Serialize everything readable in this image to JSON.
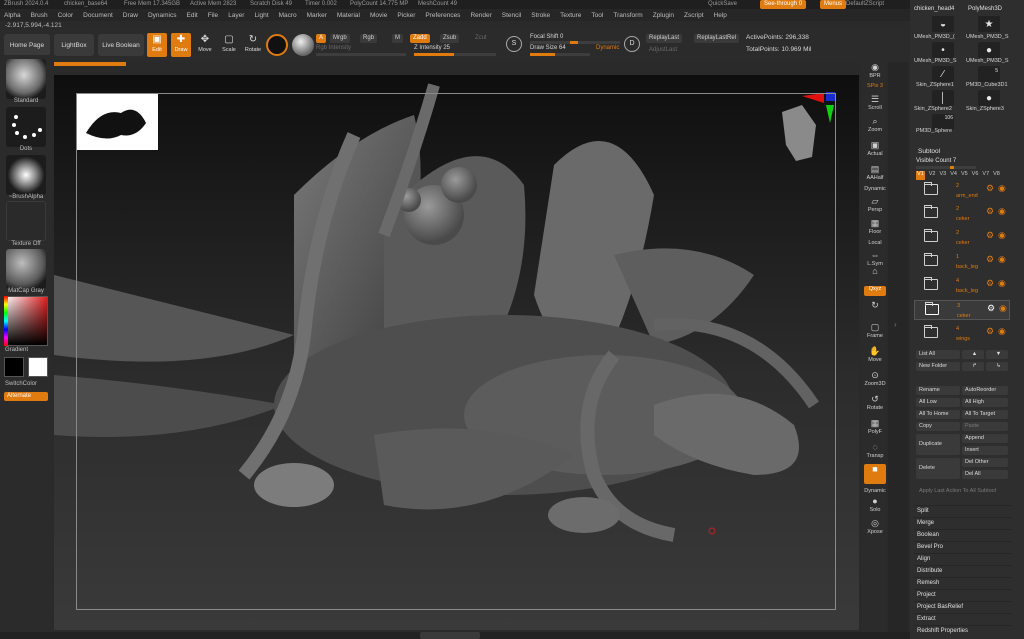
{
  "titlebar": {
    "app": "ZBrush 2024.0.4",
    "doc": "chicken_base64",
    "free_mem": "Free Mem 17.345GB",
    "active_mem": "Active Mem 2823",
    "scratch": "Scratch Disk 49",
    "timer": "Timer 0.002",
    "polycount": "PolyCount 14.775 MP",
    "meshcount": "MeshCount 49",
    "quicksave": "QuickSave",
    "see_through": "See-through 0",
    "menus": "Menus",
    "default_script": "DefaultZScript"
  },
  "menubar": [
    "Alpha",
    "Brush",
    "Color",
    "Document",
    "Draw",
    "Dynamics",
    "Edit",
    "File",
    "Layer",
    "Light",
    "Macro",
    "Marker",
    "Material",
    "Movie",
    "Picker",
    "Preferences",
    "Render",
    "Stencil",
    "Stroke",
    "Texture",
    "Tool",
    "Transform",
    "Zplugin",
    "Zscript",
    "Help"
  ],
  "coords": "-2.917,5.994,-4.121",
  "toolbar": {
    "home_page": "Home Page",
    "lightbox": "LightBox",
    "live_boolean": "Live Boolean",
    "edit": "Edit",
    "draw": "Draw",
    "move": "Move",
    "scale": "Scale",
    "rotate": "Rotate",
    "a_chip": "A",
    "mrgb": "Mrgb",
    "rgb": "Rgb",
    "m": "M",
    "zadd": "Zadd",
    "zsub": "Zsub",
    "zcut": "Zcut",
    "rgb_intensity": "Rgb Intensity",
    "z_intensity": "Z Intensity 25",
    "focal_shift": "Focal Shift 0",
    "draw_size": "Draw Size 64",
    "dynamic": "Dynamic",
    "replay_last": "ReplayLast",
    "replay_last_rel": "ReplayLastRel",
    "adjust_last": "AdjustLast",
    "active_points": "ActivePoints: 296,338",
    "total_points": "TotalPoints: 10.969 Mil"
  },
  "leftshelf": {
    "standard": "Standard",
    "dots": "Dots",
    "brush_alpha": "~BrushAlpha",
    "texture_off": "Texture Off",
    "matcap": "MatCap Gray",
    "gradient": "Gradient",
    "switch_color": "SwitchColor",
    "alternate": "Alternate"
  },
  "rightshelf": [
    {
      "label": "BPR",
      "icon": "bpr-icon"
    },
    {
      "label": "SPix 3",
      "icon": "spix-icon"
    },
    {
      "label": "Scroll",
      "icon": "scroll-icon"
    },
    {
      "label": "Zoom",
      "icon": "zoom-icon"
    },
    {
      "label": "Actual",
      "icon": "actual-icon"
    },
    {
      "label": "AAHalf",
      "icon": "aahalf-icon"
    },
    {
      "label": "Dynamic",
      "icon": "dynamic-icon"
    },
    {
      "label": "Persp",
      "icon": "persp-icon"
    },
    {
      "label": "Floor",
      "icon": "floor-icon"
    },
    {
      "label": "Local",
      "icon": "local-icon"
    },
    {
      "label": "L.Sym",
      "icon": "lsym-icon"
    },
    {
      "label": "Lock",
      "icon": "lock-icon"
    },
    {
      "label": "Qxyz",
      "icon": "xyz-icon"
    },
    {
      "label": "Frame",
      "icon": "frame-icon"
    },
    {
      "label": "Move",
      "icon": "move-icon"
    },
    {
      "label": "Zoom3D",
      "icon": "zoom3d-icon"
    },
    {
      "label": "Rotate",
      "icon": "rotate-icon"
    },
    {
      "label": "PolyF",
      "icon": "polyf-icon"
    },
    {
      "label": "Transp",
      "icon": "transp-icon"
    },
    {
      "label": "Dynamic",
      "icon": "dynamic2-icon"
    },
    {
      "label": "Solo",
      "icon": "solo-icon"
    },
    {
      "label": "Xpose",
      "icon": "xpose-icon"
    }
  ],
  "tools": [
    {
      "label": "chicken_head4"
    },
    {
      "label": "PolyMesh3D"
    },
    {
      "label": "UMesh_PM3D_("
    },
    {
      "label": "UMesh_PM3D_S"
    },
    {
      "label": "UMesh_PM3D_S"
    },
    {
      "label": "UMesh_PM3D_S"
    },
    {
      "label": "Skin_ZSphere1"
    },
    {
      "label": "PM3D_Cube3D1"
    },
    {
      "label": "Skin_ZSphere2"
    },
    {
      "label": "Skin_ZSphere3"
    },
    {
      "label": "PM3D_Sphere"
    }
  ],
  "tool_badges": {
    "five": "5",
    "one_oh_six": "106"
  },
  "subtool": {
    "title": "Subtool",
    "visible_count": "Visible Count 7",
    "tabs": [
      "V1",
      "V2",
      "V3",
      "V4",
      "V5",
      "V6",
      "V7",
      "V8"
    ],
    "rows": [
      {
        "num": "2",
        "name": "arm_end"
      },
      {
        "num": "2",
        "name": "ceker"
      },
      {
        "num": "2",
        "name": "ceker"
      },
      {
        "num": "1",
        "name": "back_leg"
      },
      {
        "num": "4",
        "name": "back_leg"
      },
      {
        "num": "3",
        "name": "ceker"
      },
      {
        "num": "4",
        "name": "wings"
      }
    ],
    "list_all": "List All",
    "new_folder": "New Folder",
    "rename": "Rename",
    "auto_reorder": "AutoReorder",
    "all_low": "All Low",
    "all_high": "All High",
    "all_to_home": "All To Home",
    "all_to_target": "All To Target",
    "copy": "Copy",
    "paste": "Paste",
    "duplicate": "Duplicate",
    "append": "Append",
    "insert": "Insert",
    "delete": "Delete",
    "del_other": "Del Other",
    "del_all": "Del All",
    "apply_last": "Apply Last Action To All Subtool"
  },
  "menu_list": [
    "Split",
    "Merge",
    "Boolean",
    "Bevel Pro",
    "Align",
    "Distribute",
    "Remesh",
    "Project",
    "Project BasRelief",
    "Extract",
    "Redshift Properties"
  ],
  "colors": {
    "accent": "#e07b10",
    "panel": "#2e2e2e",
    "canvas": "#1a1a1a"
  }
}
